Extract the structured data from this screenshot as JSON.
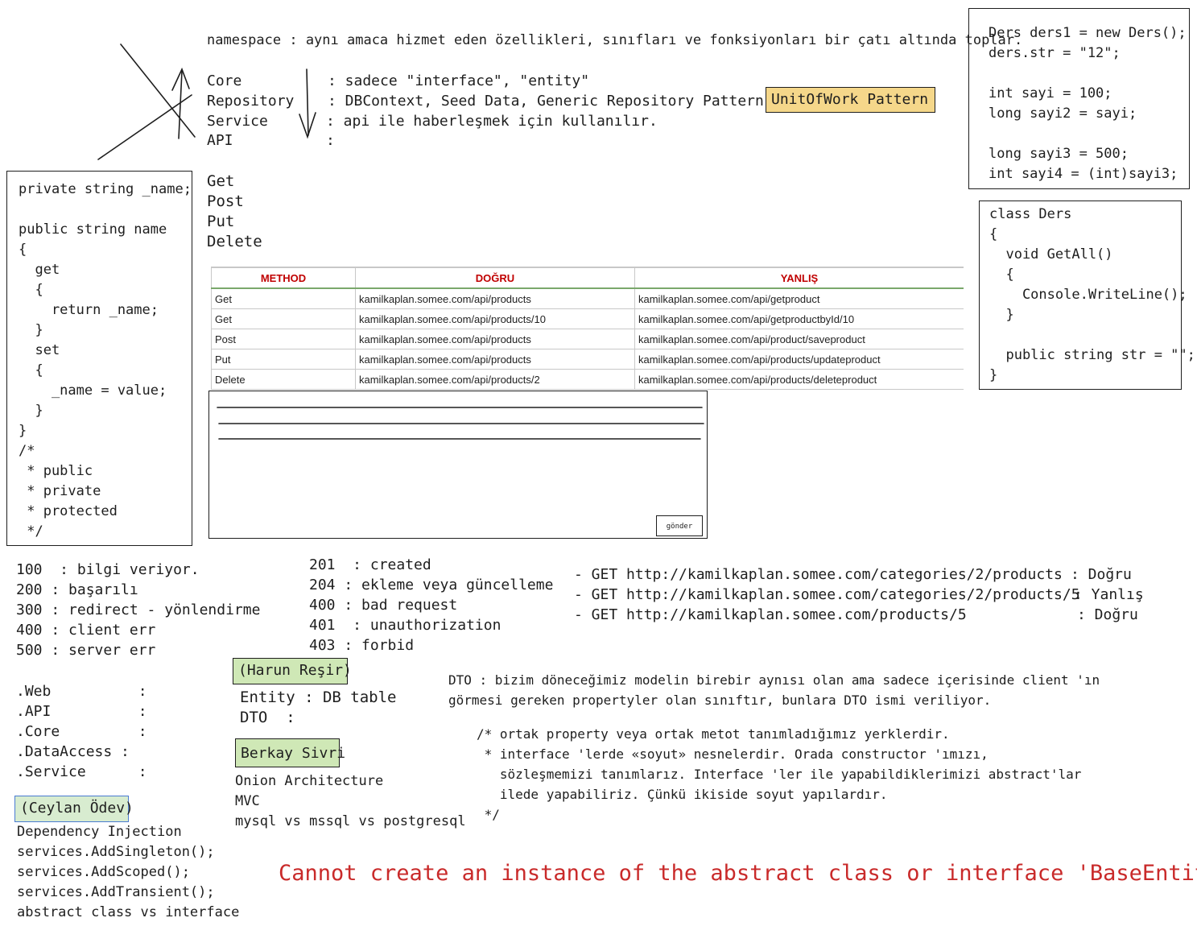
{
  "namespace_line": "namespace : aynı amaca hizmet eden özellikleri, sınıfları ve fonksiyonları bir çatı altında toplar.",
  "layers": [
    {
      "name": "Core",
      "desc": ": sadece \"interface\", \"entity\""
    },
    {
      "name": "Repository",
      "desc": ": DBContext, Seed Data, Generic Repository Pattern,"
    },
    {
      "name": "Service",
      "desc": ": api ile haberleşmek için kullanılır."
    },
    {
      "name": "API",
      "desc": ":"
    }
  ],
  "unit_of_work": "UnitOfWork Pattern",
  "http_verbs": [
    "Get",
    "Post",
    "Put",
    "Delete"
  ],
  "property_code": "private string _name;\n\npublic string name\n{\n  get\n  {\n    return _name;\n  }\n  set\n  {\n    _name = value;\n  }\n}\n/*\n * public\n * private\n * protected\n */",
  "ders_code": "Ders ders1 = new Ders();\nders.str = \"12\";\n\nint sayi = 100;\nlong sayi2 = sayi;\n\nlong sayi3 = 500;\nint sayi4 = (int)sayi3;",
  "class_code": "class Ders\n{\n  void GetAll()\n  {\n    Console.WriteLine();\n  }\n\n  public string str = \"\";\n}",
  "api_table": {
    "headers": [
      "METHOD",
      "DOĞRU",
      "YANLIŞ"
    ],
    "rows": [
      [
        "Get",
        "kamilkaplan.somee.com/api/products",
        "kamilkaplan.somee.com/api/getproduct"
      ],
      [
        "Get",
        "kamilkaplan.somee.com/api/products/10",
        "kamilkaplan.somee.com/api/getproductbyId/10"
      ],
      [
        "Post",
        "kamilkaplan.somee.com/api/products",
        "kamilkaplan.somee.com/api/product/saveproduct"
      ],
      [
        "Put",
        "kamilkaplan.somee.com/api/products",
        "kamilkaplan.somee.com/api/products/updateproduct"
      ],
      [
        "Delete",
        "kamilkaplan.somee.com/api/products/2",
        "kamilkaplan.somee.com/api/products/deleteproduct"
      ]
    ]
  },
  "form_button": "gönder",
  "status_codes_left": "100  : bilgi veriyor.\n200 : başarılı\n300 : redirect - yönlendirme\n400 : client err\n500 : server err",
  "status_codes_mid": "201  : created\n204 : ekleme veya güncelleme\n400 : bad request\n401  : unauthorization\n403 : forbid",
  "get_examples": [
    {
      "url": "- GET http://kamilkaplan.somee.com/categories/2/products",
      "verdict": ": Doğru"
    },
    {
      "url": "- GET http://kamilkaplan.somee.com/categories/2/products/5",
      "verdict": ": Yanlış"
    },
    {
      "url": "- GET http://kamilkaplan.somee.com/products/5",
      "verdict": ": Doğru"
    }
  ],
  "projects": ".Web          :\n.API          :\n.Core         :\n.DataAccess :\n.Service      :",
  "harun_label": "(Harun Reşir)",
  "entity_dto": "Entity : DB table\nDTO  :",
  "berkay_label": "Berkay Sivri",
  "berkay_items": "Onion Architecture\nMVC\nmysql vs mssql vs postgresql",
  "ceylan_label": "(Ceylan Ödev)",
  "ceylan_items": "Dependency Injection\nservices.AddSingleton();\nservices.AddScoped();\nservices.AddTransient();\nabstract class vs interface",
  "dto_desc": "DTO : bizim döneceğimiz modelin birebir aynısı olan ama sadece içerisinde client 'ın\ngörmesi gereken propertyler olan sınıftır, bunlara DTO ismi veriliyor.",
  "interface_comment": "/* ortak property veya ortak metot tanımladığımız yerklerdir.\n * interface 'lerde «soyut» nesnelerdir. Orada constructor 'ımızı,\n   sözleşmemizi tanımlarız. Interface 'ler ile yapabildiklerimizi abstract'lar\n   ilede yapabiliriz. Çünkü ikiside soyut yapılardır.\n */",
  "error_message": "Cannot create an instance of the abstract class or interface 'BaseEntity'",
  "colors": {
    "highlight_yellow": "#f5d78a",
    "highlight_green": "#cfe8b6",
    "error_red": "#c92a2a",
    "header_red": "#c00000"
  }
}
